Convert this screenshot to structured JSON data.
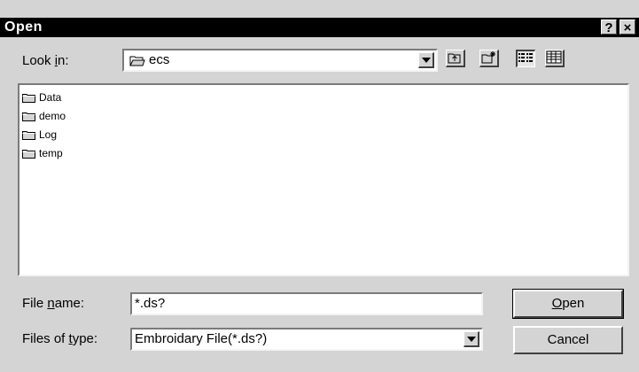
{
  "dialog": {
    "title": "Open",
    "help_label": "?",
    "close_label": "×"
  },
  "lookin": {
    "label_pre": "Look ",
    "label_u": "i",
    "label_post": "n:",
    "value": "ecs"
  },
  "files": [
    {
      "name": "Data"
    },
    {
      "name": "demo"
    },
    {
      "name": "Log"
    },
    {
      "name": "temp"
    }
  ],
  "filename": {
    "label_pre": "File ",
    "label_u": "n",
    "label_post": "ame:",
    "value": "*.ds?"
  },
  "filetype": {
    "label_pre": "Files of ",
    "label_u": "t",
    "label_post": "ype:",
    "value": "Embroidary File(*.ds?)"
  },
  "buttons": {
    "open_u": "O",
    "open_rest": "pen",
    "cancel": "Cancel"
  }
}
